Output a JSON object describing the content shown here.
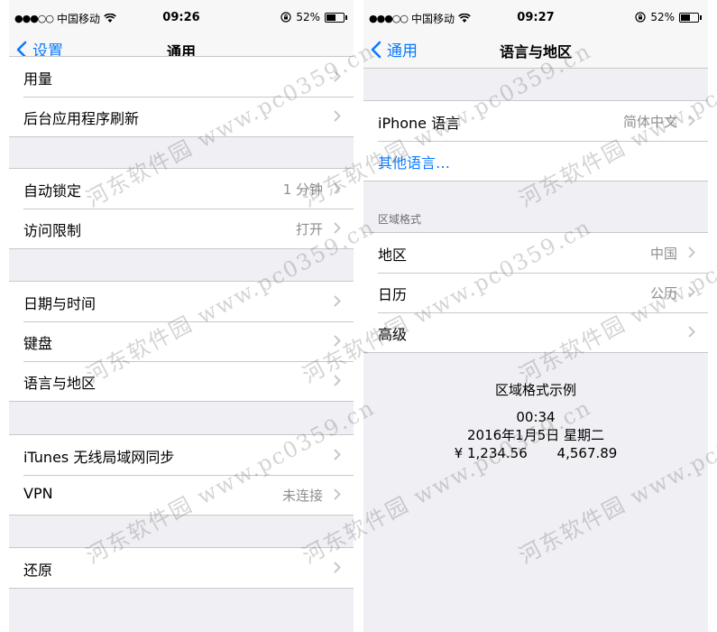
{
  "left": {
    "status": {
      "carrier": "中国移动",
      "time": "09:26",
      "battery": "52%"
    },
    "nav": {
      "back": "设置",
      "title": "通用"
    },
    "groups": [
      {
        "rows": [
          {
            "label": "用量"
          },
          {
            "label": "后台应用程序刷新"
          }
        ]
      },
      {
        "rows": [
          {
            "label": "自动锁定",
            "value": "1 分钟"
          },
          {
            "label": "访问限制",
            "value": "打开"
          }
        ]
      },
      {
        "rows": [
          {
            "label": "日期与时间"
          },
          {
            "label": "键盘"
          },
          {
            "label": "语言与地区"
          }
        ]
      },
      {
        "rows": [
          {
            "label": "iTunes 无线局域网同步"
          },
          {
            "label": "VPN",
            "value": "未连接"
          }
        ]
      },
      {
        "rows": [
          {
            "label": "还原"
          }
        ]
      }
    ]
  },
  "right": {
    "status": {
      "carrier": "中国移动",
      "time": "09:27",
      "battery": "52%"
    },
    "nav": {
      "back": "通用",
      "title": "语言与地区"
    },
    "group1": {
      "rows": [
        {
          "label": "iPhone 语言",
          "value": "简体中文"
        },
        {
          "label": "其他语言…"
        }
      ]
    },
    "region_header": "区域格式",
    "group2": {
      "rows": [
        {
          "label": "地区",
          "value": "中国"
        },
        {
          "label": "日历",
          "value": "公历"
        },
        {
          "label": "高级"
        }
      ]
    },
    "example": {
      "title": "区域格式示例",
      "time": "00:34",
      "date": "2016年1月5日 星期二",
      "amount1": "¥ 1,234.56",
      "amount2": "4,567.89"
    }
  },
  "watermark": "河东软件园 www.pc0359.cn",
  "colors": {
    "accent": "#0a7aff",
    "background": "#efeff4",
    "separator": "#c8c7cc",
    "secondary_text": "#8e8e93"
  }
}
